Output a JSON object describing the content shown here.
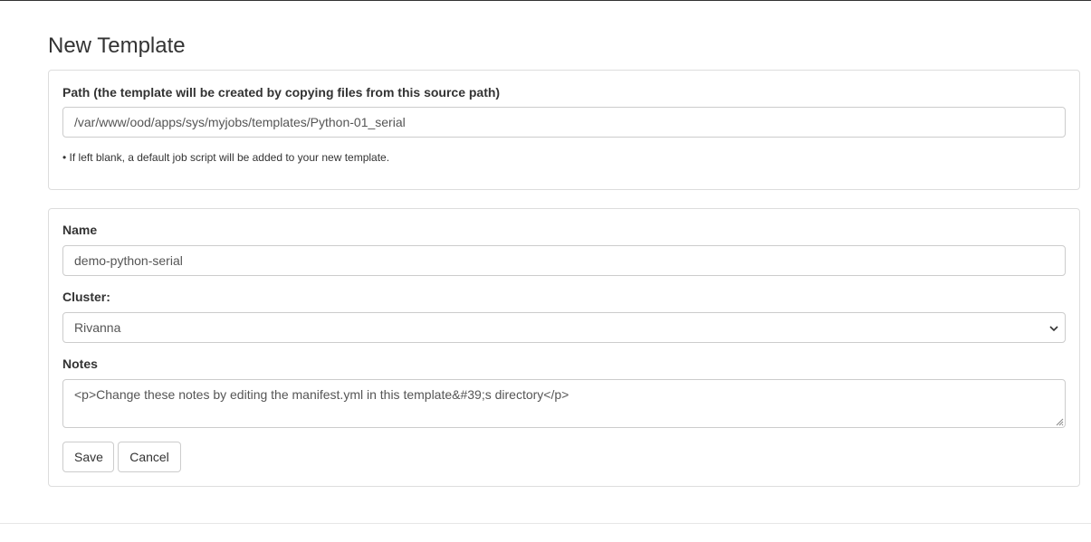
{
  "page": {
    "title": "New Template"
  },
  "path_panel": {
    "label": "Path (the template will be created by copying files from this source path)",
    "value": "/var/www/ood/apps/sys/myjobs/templates/Python-01_serial",
    "help": "• If left blank, a default job script will be added to your new template."
  },
  "form": {
    "name_label": "Name",
    "name_value": "demo-python-serial",
    "cluster_label": "Cluster:",
    "cluster_value": "Rivanna",
    "notes_label": "Notes",
    "notes_value": "<p>Change these notes by editing the manifest.yml in this template&#39;s directory</p>"
  },
  "actions": {
    "save_label": "Save",
    "cancel_label": "Cancel"
  },
  "icons": {
    "select": "chevron-down-icon",
    "textarea": "resize-grip-icon"
  }
}
